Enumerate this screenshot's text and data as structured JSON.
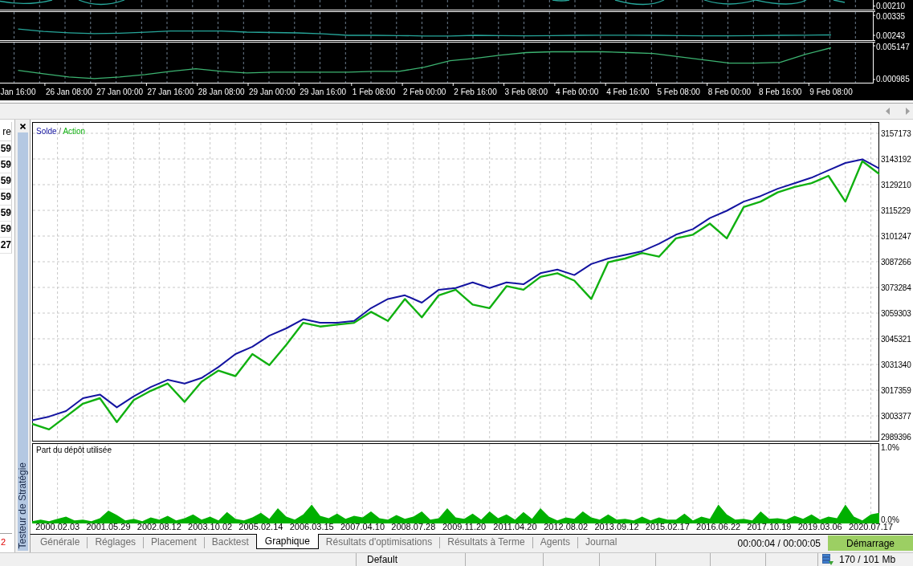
{
  "indicator_panel": {
    "panes": [
      {
        "kind": "wave",
        "scale_label": "0.00210"
      },
      {
        "kind": "chart",
        "chart_data": {
          "type": "line",
          "grid": true,
          "ylim": [
            0.00221,
            0.0035
          ],
          "yticks": [
            {
              "value": 0.00335,
              "label": "0.00335"
            },
            {
              "value": 0.00243,
              "label": "0.00243"
            }
          ],
          "categories": [
            null,
            null,
            null,
            null,
            null,
            null,
            null,
            null,
            null,
            null,
            null,
            null,
            null,
            null,
            null,
            null,
            null,
            null,
            null,
            null,
            null,
            null,
            null,
            null,
            null,
            null,
            null,
            null,
            null,
            null,
            null,
            null,
            null,
            null
          ],
          "series": [
            {
              "color": "#26a69a",
              "values": [
                0.00272,
                0.00261,
                0.00255,
                0.00251,
                0.00253,
                0.00257,
                0.00263,
                0.00263,
                0.00263,
                0.00258,
                0.00256,
                0.00254,
                0.0025,
                0.00243,
                0.00243,
                0.00242,
                0.0024,
                0.0024,
                0.00243,
                0.00242,
                0.00241,
                0.00242,
                0.00243,
                0.00244,
                0.00244,
                0.00243,
                0.00242,
                0.00241,
                0.00241,
                0.00242,
                0.00243,
                0.00244,
                0.00245,
                null
              ]
            }
          ]
        }
      },
      {
        "kind": "chart",
        "chart_data": {
          "type": "line",
          "grid": true,
          "ylim": [
            0.000588,
            0.005543
          ],
          "yticks": [
            {
              "value": 0.005147,
              "label": "0.005147"
            },
            {
              "value": 0.000985,
              "label": "0.000985"
            }
          ],
          "categories": [
            "Jan 16:00",
            null,
            "26 Jan 08:00",
            null,
            "27 Jan 00:00",
            null,
            "27 Jan 16:00",
            null,
            "28 Jan 08:00",
            null,
            "29 Jan 00:00",
            null,
            "29 Jan 16:00",
            null,
            "1 Feb 08:00",
            null,
            "2 Feb 00:00",
            null,
            "2 Feb 16:00",
            null,
            "3 Feb 08:00",
            null,
            "4 Feb 00:00",
            null,
            "4 Feb 16:00",
            null,
            "5 Feb 08:00",
            null,
            "8 Feb 00:00",
            null,
            "8 Feb 16:00",
            null,
            "9 Feb 08:00",
            null
          ],
          "series": [
            {
              "color": "#3cb371",
              "values": [
                0.0021,
                0.0017,
                0.0013,
                0.0011,
                0.0013,
                0.0016,
                0.002,
                0.0023,
                0.002,
                0.0018,
                0.0019,
                0.0019,
                0.0019,
                0.0019,
                0.002,
                0.002,
                0.0025,
                0.0033,
                0.0036,
                0.004,
                0.0043,
                0.0044,
                0.0044,
                0.0044,
                0.0043,
                0.0042,
                0.0038,
                0.0034,
                0.003,
                0.003,
                0.0031,
                0.0041,
                0.0049,
                null
              ]
            }
          ]
        }
      }
    ]
  },
  "side_table": {
    "header": "re",
    "cells": [
      "59",
      "59",
      "59",
      "59",
      "59",
      "59",
      "27"
    ],
    "footer": "2"
  },
  "tester": {
    "title": "Testeur de Stratégie",
    "balance_chart": {
      "legend_separator": "/",
      "chart_data": {
        "type": "line",
        "grid": true,
        "ylim": [
          2989396,
          3163290
        ],
        "yticks": [
          3157173,
          3143192,
          3129210,
          3115229,
          3101247,
          3087266,
          3073284,
          3059303,
          3045321,
          3031340,
          3017359,
          3003377,
          2989396
        ],
        "categories": [
          null,
          null,
          null,
          null,
          null,
          null,
          null,
          null,
          null,
          null,
          null,
          null,
          null,
          null,
          null,
          null,
          null,
          null,
          null,
          null,
          null,
          null,
          null,
          null,
          null,
          null,
          null,
          null,
          null,
          null,
          null,
          null,
          null,
          null,
          null,
          null,
          null,
          null,
          null,
          null,
          null,
          null,
          null,
          null,
          null,
          null,
          null,
          null,
          null,
          null,
          null
        ],
        "series": [
          {
            "name": "Solde",
            "color": "#1414a0",
            "values": [
              3001000,
              3003000,
              3006000,
              3013000,
              3015000,
              3008000,
              3014000,
              3019000,
              3023000,
              3021000,
              3024000,
              3030000,
              3037000,
              3041000,
              3047000,
              3051000,
              3056000,
              3054000,
              3054000,
              3055000,
              3062000,
              3067000,
              3069000,
              3065000,
              3072000,
              3073000,
              3076000,
              3073000,
              3076000,
              3075000,
              3081000,
              3083000,
              3080000,
              3086000,
              3089000,
              3091000,
              3093000,
              3097000,
              3102000,
              3105000,
              3111000,
              3115000,
              3120000,
              3123000,
              3127000,
              3130000,
              3133000,
              3137000,
              3141000,
              3143000,
              3138000
            ]
          },
          {
            "name": "Action",
            "color": "#10b010",
            "values": [
              2999000,
              2996000,
              3003000,
              3010000,
              3013000,
              3000000,
              3012000,
              3017000,
              3021000,
              3011000,
              3022000,
              3028000,
              3025000,
              3037000,
              3031000,
              3042000,
              3054000,
              3052000,
              3053000,
              3054000,
              3060000,
              3055000,
              3067000,
              3057000,
              3069000,
              3072000,
              3064000,
              3062000,
              3074000,
              3072000,
              3079000,
              3081000,
              3077000,
              3067000,
              3087000,
              3089000,
              3092000,
              3090000,
              3100000,
              3102000,
              3108000,
              3100000,
              3117000,
              3120000,
              3125000,
              3128000,
              3130000,
              3134000,
              3120000,
              3142000,
              3135000
            ]
          }
        ]
      }
    },
    "deposit_chart": {
      "chart_data": {
        "type": "area",
        "grid": true,
        "title": "Part du dépôt utilisée",
        "ylim": [
          0,
          1.06
        ],
        "yticks": [
          {
            "value": 1,
            "label": "1.0%"
          },
          {
            "value": 0,
            "label": "0.0%"
          }
        ],
        "categories": [
          null,
          null,
          null,
          "2000.02.03",
          null,
          null,
          null,
          null,
          null,
          "2001.05.29",
          null,
          null,
          null,
          null,
          null,
          "2002.08.12",
          null,
          null,
          null,
          null,
          null,
          "2003.10.02",
          null,
          null,
          null,
          null,
          null,
          "2005.02.14",
          null,
          null,
          null,
          null,
          null,
          "2006.03.15",
          null,
          null,
          null,
          null,
          null,
          "2007.04.10",
          null,
          null,
          null,
          null,
          null,
          "2008.07.28",
          null,
          null,
          null,
          null,
          null,
          "2009.11.20",
          null,
          null,
          null,
          null,
          null,
          "2011.04.20",
          null,
          null,
          null,
          null,
          null,
          "2012.08.02",
          null,
          null,
          null,
          null,
          null,
          "2013.09.12",
          null,
          null,
          null,
          null,
          null,
          "2015.02.17",
          null,
          null,
          null,
          null,
          null,
          "2016.06.22",
          null,
          null,
          null,
          null,
          null,
          "2017.10.19",
          null,
          null,
          null,
          null,
          null,
          "2019.03.06",
          null,
          null,
          null,
          null,
          null,
          "2020.07.17",
          null
        ],
        "series": [
          {
            "color": "#00b000",
            "values": [
              0.03,
              0.05,
              0.03,
              0.06,
              0.09,
              0.04,
              0.05,
              0.03,
              0.07,
              0.17,
              0.11,
              0.04,
              0.06,
              0.03,
              0.08,
              0.05,
              0.1,
              0.04,
              0.07,
              0.12,
              0.05,
              0.09,
              0.04,
              0.15,
              0.06,
              0.04,
              0.08,
              0.14,
              0.06,
              0.2,
              0.09,
              0.05,
              0.12,
              0.25,
              0.1,
              0.07,
              0.13,
              0.06,
              0.1,
              0.08,
              0.16,
              0.07,
              0.05,
              0.11,
              0.06,
              0.09,
              0.16,
              0.05,
              0.07,
              0.2,
              0.08,
              0.06,
              0.13,
              0.05,
              0.16,
              0.07,
              0.12,
              0.05,
              0.15,
              0.06,
              0.2,
              0.09,
              0.04,
              0.08,
              0.06,
              0.16,
              0.08,
              0.05,
              0.12,
              0.05,
              0.06,
              0.04,
              0.09,
              0.04,
              0.08,
              0.05,
              0.05,
              0.13,
              0.04,
              0.09,
              0.06,
              0.25,
              0.12,
              0.05,
              0.06,
              0.04,
              0.16,
              0.06,
              0.07,
              0.05,
              0.1,
              0.06,
              0.12,
              0.05,
              0.09,
              0.07,
              0.25,
              0.09,
              0.04,
              0.12,
              0.14
            ]
          }
        ]
      }
    },
    "tabs": [
      {
        "label": "Générale",
        "selected": false
      },
      {
        "label": "Réglages",
        "selected": false
      },
      {
        "label": "Placement",
        "selected": false
      },
      {
        "label": "Backtest",
        "selected": false
      },
      {
        "label": "Graphique",
        "selected": true
      },
      {
        "label": "Résultats d'optimisations",
        "selected": false
      },
      {
        "label": "Résultats à Terme",
        "selected": false
      },
      {
        "label": "Agents",
        "selected": false
      },
      {
        "label": "Journal",
        "selected": false
      }
    ],
    "timer": "00:00:04 / 00:00:05",
    "start_button": "Démarrage"
  },
  "status_bar": {
    "profile": "Default",
    "memory": "170 / 101 Mb"
  }
}
